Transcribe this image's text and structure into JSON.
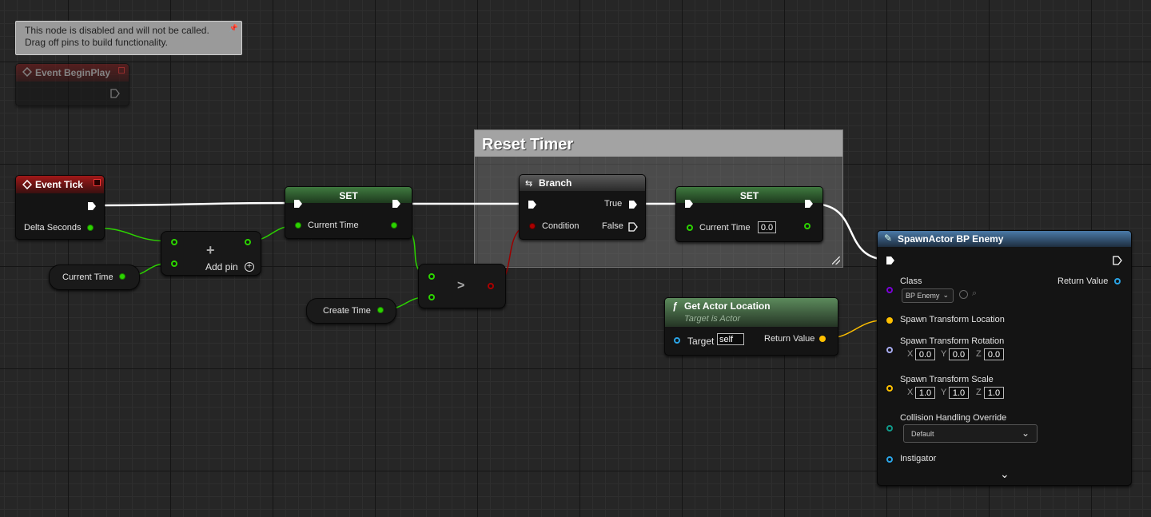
{
  "tooltip": {
    "line1": "This node is disabled and will not be called.",
    "line2": "Drag off pins to build functionality."
  },
  "comment": {
    "title": "Reset Timer"
  },
  "nodes": {
    "begin_play": {
      "title": "Event BeginPlay"
    },
    "event_tick": {
      "title": "Event Tick",
      "pin_delta": "Delta Seconds"
    },
    "var_current_time": {
      "label": "Current Time"
    },
    "add_node": {
      "symbol": "+",
      "add_pin": "Add pin"
    },
    "set1": {
      "title": "SET",
      "pin": "Current Time"
    },
    "var_create_time": {
      "label": "Create Time"
    },
    "compare": {
      "symbol": ">"
    },
    "branch": {
      "title": "Branch",
      "pin_condition": "Condition",
      "pin_true": "True",
      "pin_false": "False"
    },
    "set2": {
      "title": "SET",
      "pin": "Current Time",
      "value": "0.0"
    },
    "get_actor_location": {
      "title": "Get Actor Location",
      "subtitle": "Target is Actor",
      "pin_target": "Target",
      "target_value": "self",
      "pin_return": "Return Value"
    },
    "spawn_actor": {
      "title": "SpawnActor BP Enemy",
      "pin_class": "Class",
      "class_value": "BP Enemy",
      "pin_return": "Return Value",
      "pin_location": "Spawn Transform Location",
      "pin_rotation": "Spawn Transform Rotation",
      "rotation": {
        "x_label": "X",
        "x": "0.0",
        "y_label": "Y",
        "y": "0.0",
        "z_label": "Z",
        "z": "0.0"
      },
      "pin_scale": "Spawn Transform Scale",
      "scale": {
        "x_label": "X",
        "x": "1.0",
        "y_label": "Y",
        "y": "1.0",
        "z_label": "Z",
        "z": "1.0"
      },
      "pin_collision": "Collision Handling Override",
      "collision_value": "Default",
      "pin_instigator": "Instigator"
    }
  },
  "colors": {
    "exec_wire": "#ffffff",
    "float_wire": "#2cd300",
    "bool_wire": "#9b0000",
    "vector_wire": "#ffc000",
    "event_header": "#8a1010",
    "set_header": "#2e6b2e",
    "spawn_header": "#3a5f85"
  }
}
